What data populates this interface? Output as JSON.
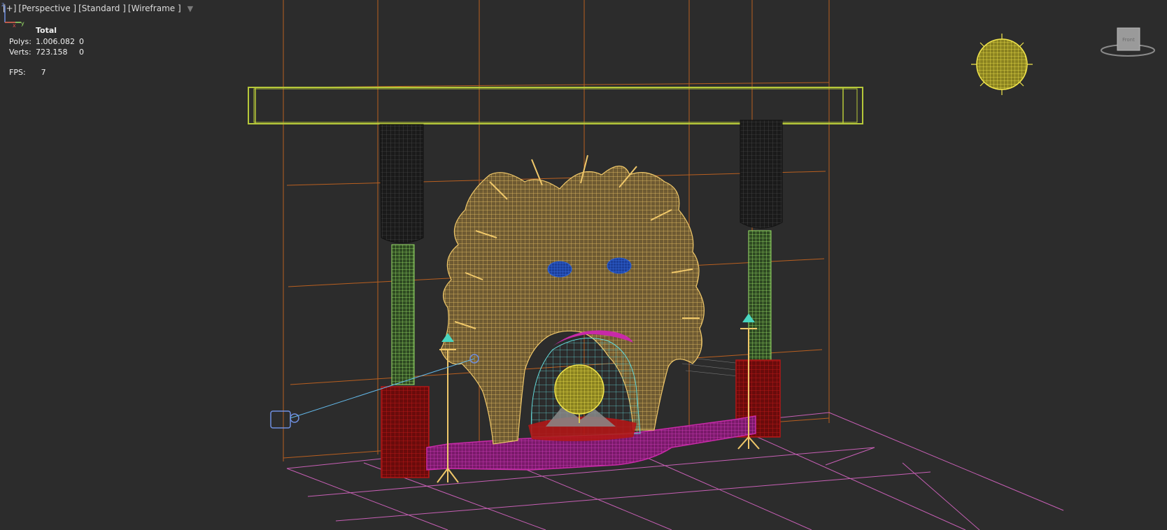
{
  "viewport": {
    "labels": [
      "[+]",
      "[Perspective ]",
      "[Standard ]",
      "[Wireframe ]"
    ]
  },
  "stats": {
    "header": "Total",
    "rows": [
      {
        "label": "Polys:",
        "total": "1.006.082",
        "selected": "0"
      },
      {
        "label": "Verts:",
        "total": "723.158",
        "selected": "0"
      }
    ],
    "fps_label": "FPS:",
    "fps_value": "7"
  },
  "viewcube": {
    "face_label": "Front"
  },
  "axis": {
    "x": "x",
    "y": "y",
    "z": "z"
  },
  "colors": {
    "background": "#2c2c2c",
    "grid": "#d2691e",
    "beam": "#b6c83a",
    "column_top": "#111111",
    "column_mid": "#9be36a",
    "column_base": "#b01616",
    "hearth": "#c82aa8",
    "lion": "#f0c86a",
    "sun": "#f2e64c",
    "eyes": "#2c62d8",
    "camera": "#6f8fe0",
    "floor_grid": "#d865c4"
  }
}
